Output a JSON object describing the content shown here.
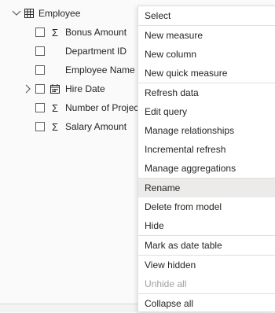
{
  "fields_pane": {
    "table": {
      "name": "Employee",
      "icon": "table-icon",
      "expanded": true
    },
    "fields": [
      {
        "label": "Bonus Amount",
        "icon": "sigma-icon",
        "checked": false,
        "expandable": false
      },
      {
        "label": "Department ID",
        "icon": "",
        "checked": false,
        "expandable": false
      },
      {
        "label": "Employee Name",
        "icon": "",
        "checked": false,
        "expandable": false
      },
      {
        "label": "Hire Date",
        "icon": "calendar-icon",
        "checked": false,
        "expandable": true
      },
      {
        "label": "Number of Projects",
        "icon": "sigma-icon",
        "checked": false,
        "expandable": false
      },
      {
        "label": "Salary Amount",
        "icon": "sigma-icon",
        "checked": false,
        "expandable": false
      }
    ]
  },
  "context_menu": {
    "items": [
      {
        "label": "Select",
        "state": "normal"
      },
      {
        "label": "New measure",
        "state": "normal"
      },
      {
        "label": "New column",
        "state": "normal"
      },
      {
        "label": "New quick measure",
        "state": "normal"
      },
      {
        "label": "Refresh data",
        "state": "normal"
      },
      {
        "label": "Edit query",
        "state": "normal"
      },
      {
        "label": "Manage relationships",
        "state": "normal"
      },
      {
        "label": "Incremental refresh",
        "state": "normal"
      },
      {
        "label": "Manage aggregations",
        "state": "normal"
      },
      {
        "label": "Rename",
        "state": "hover"
      },
      {
        "label": "Delete from model",
        "state": "normal"
      },
      {
        "label": "Hide",
        "state": "normal"
      },
      {
        "label": "Mark as date table",
        "state": "normal"
      },
      {
        "label": "View hidden",
        "state": "normal"
      },
      {
        "label": "Unhide all",
        "state": "disabled"
      },
      {
        "label": "Collapse all",
        "state": "normal"
      }
    ]
  }
}
